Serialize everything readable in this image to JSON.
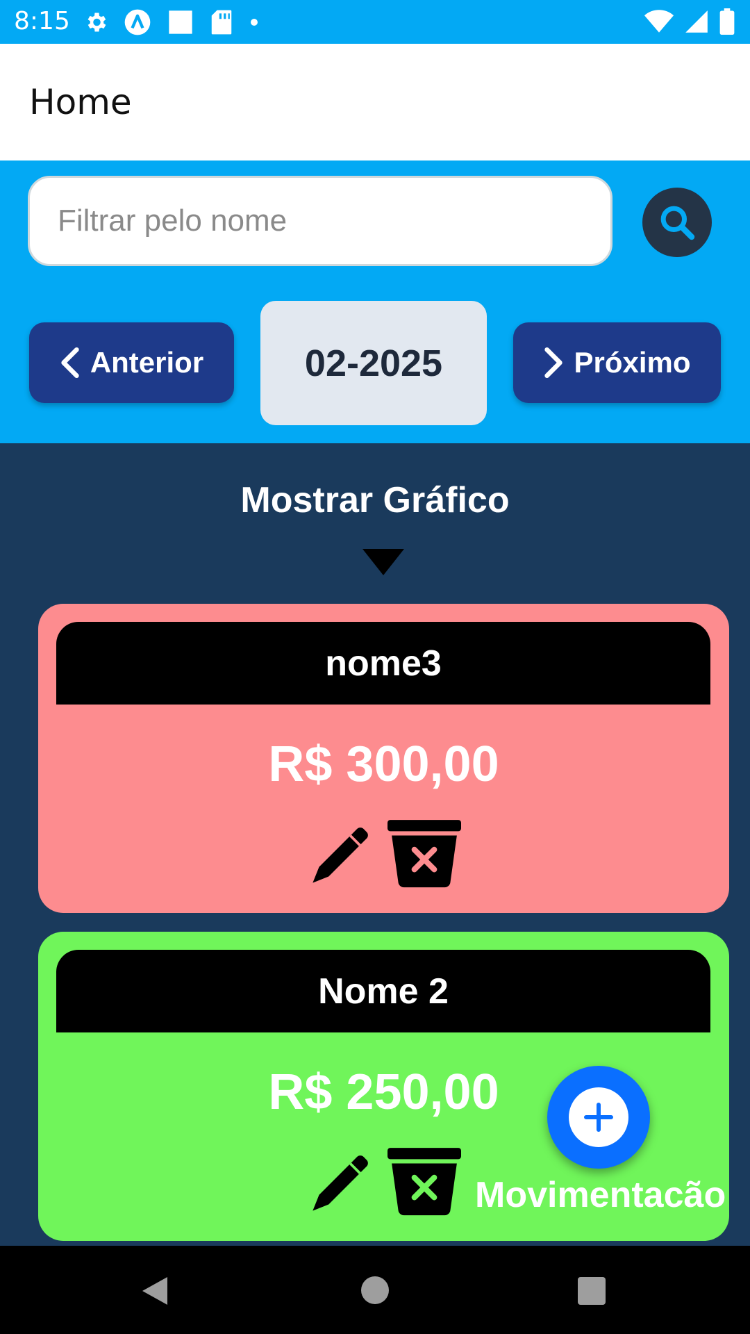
{
  "status_bar": {
    "time": "8:15",
    "left_icons": [
      "gear-icon",
      "a-circle-icon",
      "square-icon",
      "sd-card-icon",
      "dot-icon"
    ],
    "right_icons": [
      "wifi-icon",
      "signal-icon",
      "battery-icon"
    ]
  },
  "app_bar": {
    "title": "Home"
  },
  "search": {
    "placeholder": "Filtrar pelo nome",
    "value": "",
    "button_icon": "search-icon"
  },
  "month_nav": {
    "prev_label": "Anterior",
    "next_label": "Próximo",
    "current": "02-2025"
  },
  "chart_toggle": {
    "label": "Mostrar Gráfico",
    "icon": "caret-down-icon"
  },
  "cards": [
    {
      "name": "nome3",
      "value": "R$ 300,00",
      "color": "#fd8c8f"
    },
    {
      "name": "Nome 2",
      "value": "R$ 250,00",
      "color": "#70f55a"
    }
  ],
  "fab": {
    "label": "Movimentacão",
    "icon": "plus-icon",
    "color": "#0a6fff"
  },
  "colors": {
    "primary": "#03a9f4",
    "nav_button": "#1e3a8a",
    "background": "#1a3a5c",
    "search_button": "#243447"
  }
}
